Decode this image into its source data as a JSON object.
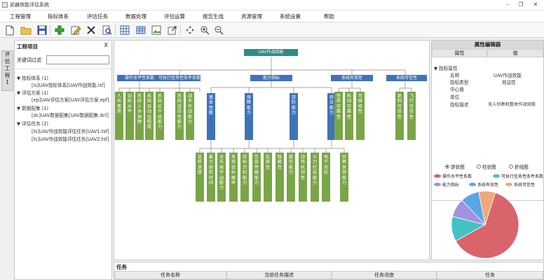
{
  "window": {
    "title": "武器效能评估系统"
  },
  "menu": [
    "工程管理",
    "指标体系",
    "评估任务",
    "数据处理",
    "评估运算",
    "报告生成",
    "资源管理",
    "系统设置",
    "帮助"
  ],
  "toolbar_icons": [
    "new-file-icon",
    "open-folder-icon",
    "save-icon",
    "add-icon",
    "edit-icon",
    "delete-icon",
    "search-doc-icon",
    "table-icon",
    "grid-icon",
    "image-doc-icon",
    "export-icon",
    "move-icon",
    "zoom-in-icon",
    "zoom-out-icon"
  ],
  "left_tab": [
    "评",
    "估",
    "工",
    "程",
    "1"
  ],
  "project_panel": {
    "title": "工程项目",
    "close": "X",
    "filter_label": "关键词过滤",
    "filter_value": "",
    "tree": [
      {
        "label": "▼ 指标体系 (1)",
        "level": 0
      },
      {
        "label": "[is]UAV指标体系[UAV作战效能.isf]",
        "level": 1
      },
      {
        "label": "▼ 评估方案 (1)",
        "level": 0
      },
      {
        "label": "[ep]UAV评估方案[UAV评估方案.epf]",
        "level": 1
      },
      {
        "label": "▼ 数据配集 (1)",
        "level": 0
      },
      {
        "label": "[dc]UAV数据配集[UAV数据配集.dcf]",
        "level": 1
      },
      {
        "label": "▼ 评估任务 (2)",
        "level": 0
      },
      {
        "label": "[ts]UAV作战效能评估任务[UAV1.tsf]",
        "level": 1
      },
      {
        "label": "[ts]UAV作战效能评估任务[UAV2.tsf]",
        "level": 1
      }
    ]
  },
  "diagram": {
    "root": "UAV作战效能",
    "level1": [
      "操作水平性系数",
      "可执行任务性条件系数",
      "能力指标",
      "系统有效性",
      "系统可信性"
    ],
    "group_a": [
      "人员素质",
      "训练水平",
      "系统人员保障",
      "系统自动化程度",
      "系统抗干扰能力",
      "系统适应性能力",
      "战术作战能力"
    ],
    "capability": [
      "基本性能",
      "保障能力",
      "突防能力",
      "综合能力"
    ],
    "group_b": [
      "任务可靠性",
      "机动可靠性",
      "可维修性"
    ],
    "group_c": [
      "复制可信性",
      "飞行可信性"
    ],
    "group_d": [
      "巡航速度",
      "最大续航时间",
      "全天候作战能力",
      "发现目标概率",
      "目标识别能力",
      "信息传输能力",
      "抗毁性",
      "隐蔽性",
      "毁伤能力",
      "战场机动性",
      "火力打击能力",
      "电子对抗",
      "侦察探测能力"
    ]
  },
  "property_panel": {
    "title": "属性编辑器",
    "col_name": "属性",
    "col_value": "值",
    "group": "▼ 指标属性",
    "props": [
      {
        "name": "名称",
        "value": "UAV作战效能"
      },
      {
        "name": "指标类型",
        "value": "效益性"
      },
      {
        "name": "中心值",
        "value": ""
      },
      {
        "name": "单位",
        "value": ""
      },
      {
        "name": "指标描述",
        "value": "无人侦察机整体作战效能"
      }
    ],
    "chart_types": [
      "饼状图",
      "柱状图",
      "折线图"
    ],
    "chart_selected": "饼状图"
  },
  "chart_data": {
    "type": "pie",
    "title": "",
    "categories": [
      "操作水平性系数",
      "可执行任务性条件系数",
      "能力指标",
      "系统有效性",
      "系统可信性"
    ],
    "values": [
      62,
      12,
      9,
      9,
      8
    ],
    "colors": [
      "#d9646c",
      "#41c3c6",
      "#a58fe0",
      "#5aa6e8",
      "#f2a77a"
    ]
  },
  "tasks": {
    "title": "任务",
    "columns": [
      "任务名称",
      "当前任务描述",
      "任务进度",
      "任务"
    ]
  }
}
